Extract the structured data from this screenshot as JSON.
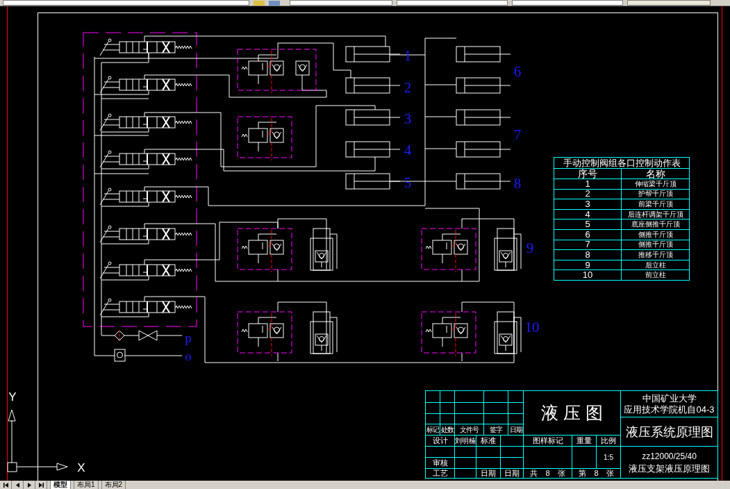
{
  "drawing": {
    "cylinder_labels": [
      "1",
      "2",
      "3",
      "4",
      "5",
      "6",
      "7",
      "8",
      "9",
      "10"
    ],
    "port_labels": [
      "p",
      "o"
    ]
  },
  "ucs": {
    "y_label": "Y",
    "x_label": "X"
  },
  "action_table": {
    "title": "手动控制阀组各口控制动作表",
    "columns": [
      "序号",
      "名称"
    ],
    "rows": [
      [
        "1",
        "伸缩梁千斤顶"
      ],
      [
        "2",
        "护帮千斤顶"
      ],
      [
        "3",
        "前梁千斤顶"
      ],
      [
        "4",
        "后连杆调架千斤顶"
      ],
      [
        "5",
        "底座侧推千斤顶"
      ],
      [
        "6",
        "侧推千斤顶"
      ],
      [
        "7",
        "侧推千斤顶"
      ],
      [
        "8",
        "推移千斤顶"
      ],
      [
        "9",
        "后立柱"
      ],
      [
        "10",
        "前立柱"
      ]
    ]
  },
  "title_block": {
    "revision_headers": [
      "标记",
      "处数",
      "文件号",
      "签字",
      "日期"
    ],
    "drawing_title": "液 压 图",
    "school": [
      "中国矿业大学",
      "应用技术学院机自04-3"
    ],
    "drawing_name": "液压系统原理图",
    "designer_label": "设计",
    "designer": "刘明楠",
    "standard_label": "标准",
    "sample_mark_label": "图样标记",
    "weight_label": "重量",
    "scale_label": "比例",
    "scale": "1:5",
    "review_label": "审核",
    "process_label": "工艺",
    "date_labels": [
      "日期",
      "日期"
    ],
    "sheets_total": "共 8 张",
    "sheet_number": "第 8 张",
    "drawing_code": "zz12000/25/40",
    "subtitle": "液压支架液压原理图"
  },
  "layout_tabs": [
    {
      "label": "模型",
      "selected": true
    },
    {
      "label": "布局1",
      "selected": false
    },
    {
      "label": "布局2",
      "selected": false
    }
  ]
}
